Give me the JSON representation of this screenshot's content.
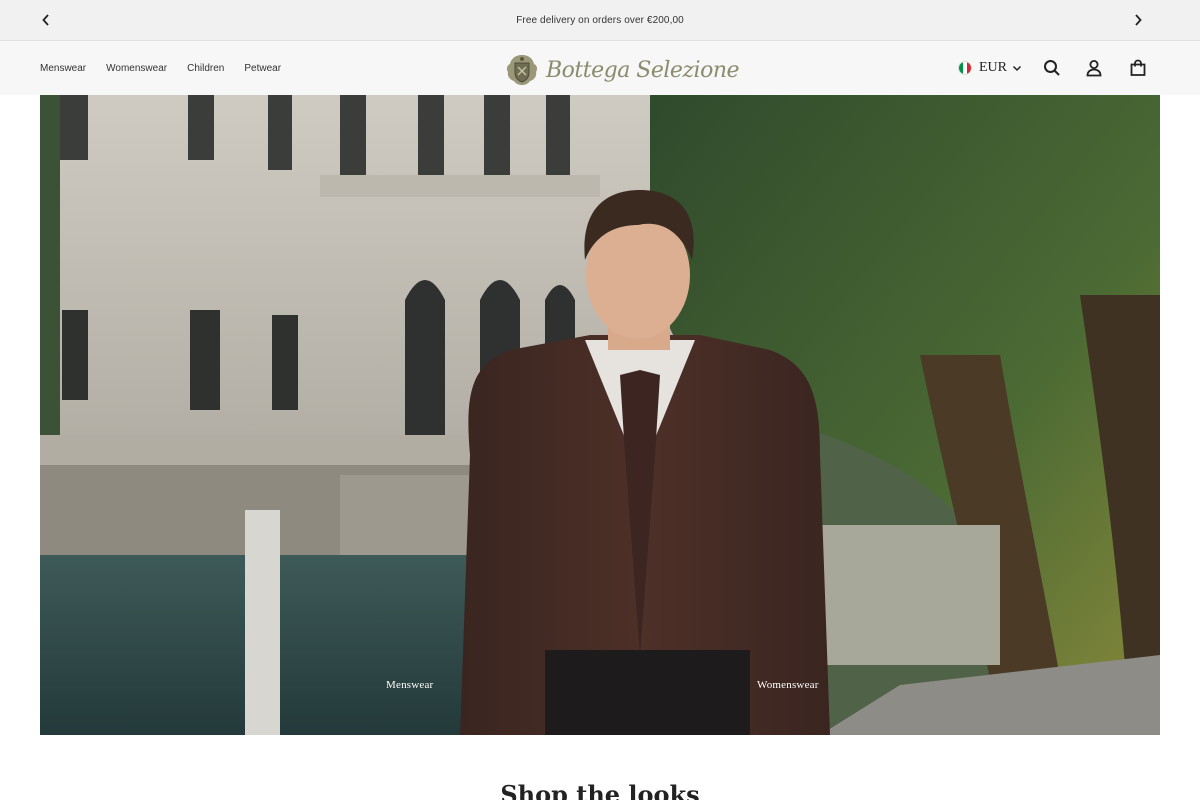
{
  "announcement": {
    "text": "Free delivery on orders over €200,00",
    "prev_icon": "chevron-left-icon",
    "next_icon": "chevron-right-icon"
  },
  "header": {
    "nav": [
      {
        "label": "Menswear"
      },
      {
        "label": "Womenswear"
      },
      {
        "label": "Children"
      },
      {
        "label": "Petwear"
      }
    ],
    "logo_text": "Bottega Selezione",
    "currency": {
      "flag": "italy-flag",
      "label": "EUR"
    },
    "icons": [
      "search-icon",
      "account-icon",
      "cart-icon"
    ]
  },
  "hero": {
    "links": {
      "menswear": "Menswear",
      "womenswear": "Womenswear"
    }
  },
  "section": {
    "title": "Shop the looks"
  },
  "colors": {
    "announce_bg": "#f1f1f1",
    "header_bg": "#f7f7f7",
    "logo": "#8b8b6e",
    "flag_green": "#009246",
    "flag_white": "#ffffff",
    "flag_red": "#ce2b37"
  }
}
